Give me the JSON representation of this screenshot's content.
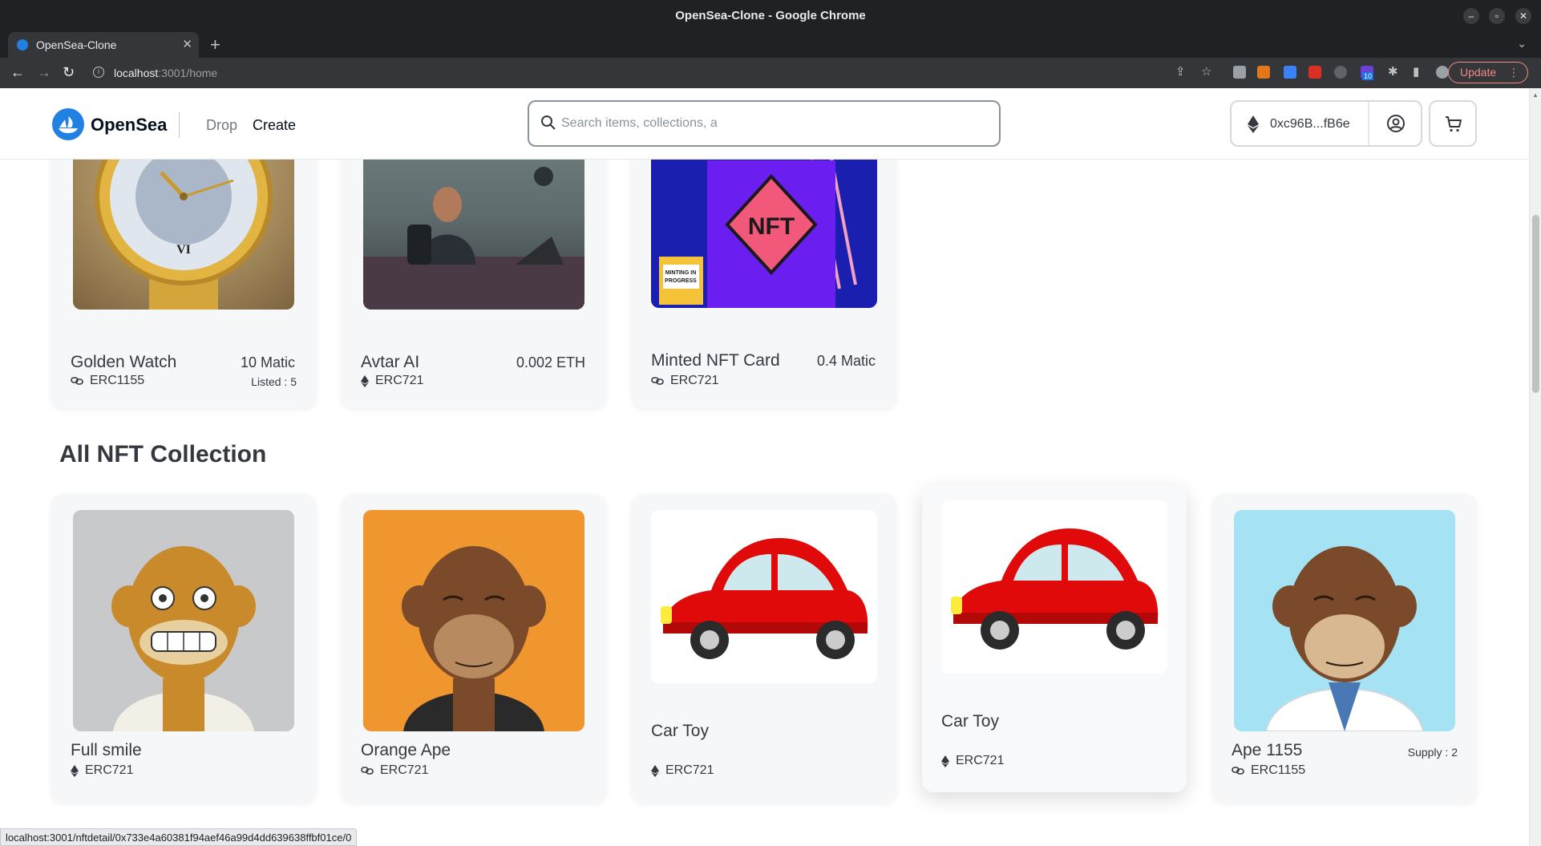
{
  "window": {
    "title": "OpenSea-Clone - Google Chrome"
  },
  "tab": {
    "title": "OpenSea-Clone"
  },
  "address_bar": {
    "url_host": "localhost",
    "url_path": ":3001/home"
  },
  "browser": {
    "update_label": "Update",
    "extension_badge": "10"
  },
  "header": {
    "logo_text": "OpenSea",
    "nav": {
      "drop": "Drop",
      "create": "Create"
    },
    "search_placeholder": "Search items, collections, a",
    "wallet_address": "0xc96B...fB6e"
  },
  "listed": [
    {
      "name": "Golden Watch",
      "price": "10 Matic",
      "standard": "ERC1155",
      "standard_icon": "link-icon",
      "meta": "Listed : 5"
    },
    {
      "name": "Avtar AI",
      "price": "0.002 ETH",
      "standard": "ERC721",
      "standard_icon": "eth-icon",
      "meta": ""
    },
    {
      "name": "Minted NFT Card",
      "price": "0.4 Matic",
      "standard": "ERC721",
      "standard_icon": "link-icon",
      "meta": "",
      "image_sign": "NFT",
      "image_sticker": "MINTING IN PROGRESS"
    }
  ],
  "collection": {
    "title": "All NFT Collection",
    "items": [
      {
        "name": "Full smile",
        "standard": "ERC721",
        "standard_icon": "eth-icon",
        "meta": ""
      },
      {
        "name": "Orange Ape",
        "standard": "ERC721",
        "standard_icon": "link-icon",
        "meta": ""
      },
      {
        "name": "Car Toy",
        "standard": "ERC721",
        "standard_icon": "eth-icon",
        "meta": ""
      },
      {
        "name": "Car Toy",
        "standard": "ERC721",
        "standard_icon": "eth-icon",
        "meta": ""
      },
      {
        "name": "Ape 1155",
        "standard": "ERC1155",
        "standard_icon": "link-icon",
        "meta": "Supply : 2"
      }
    ]
  },
  "status_bar": {
    "text": "localhost:3001/nftdetail/0x733e4a60381f94aef46a99d4dd639638ffbf01ce/0"
  },
  "colors": {
    "brand": "#2081e2",
    "text": "#353840",
    "card_bg": "#f6f7f9"
  }
}
